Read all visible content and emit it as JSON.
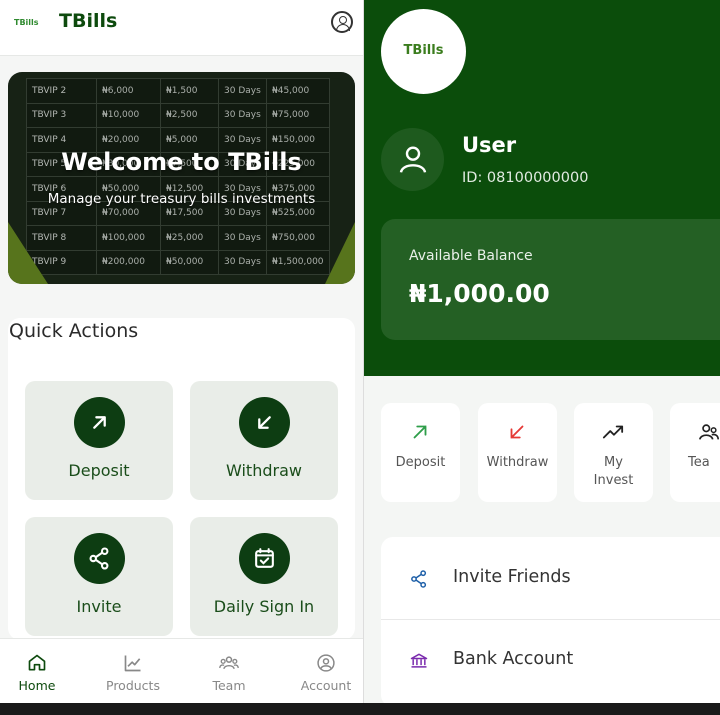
{
  "left": {
    "header": {
      "logo_text": "TBills",
      "title": "TBills",
      "account_icon": "user-circle-icon"
    },
    "hero": {
      "title": "Welcome to TBills",
      "subtitle": "Manage your treasury bills investments",
      "rows": [
        [
          "TBVIP 2",
          "₦6,000",
          "₦1,500",
          "30 Days",
          "₦45,000"
        ],
        [
          "TBVIP 3",
          "₦10,000",
          "₦2,500",
          "30 Days",
          "₦75,000"
        ],
        [
          "TBVIP 4",
          "₦20,000",
          "₦5,000",
          "30 Days",
          "₦150,000"
        ],
        [
          "TBVIP 5",
          "₦30,000",
          "₦7,500",
          "30 Days",
          "₦225,000"
        ],
        [
          "TBVIP 6",
          "₦50,000",
          "₦12,500",
          "30 Days",
          "₦375,000"
        ],
        [
          "TBVIP 7",
          "₦70,000",
          "₦17,500",
          "30 Days",
          "₦525,000"
        ],
        [
          "TBVIP 8",
          "₦100,000",
          "₦25,000",
          "30 Days",
          "₦750,000"
        ],
        [
          "TBVIP 9",
          "₦200,000",
          "₦50,000",
          "30 Days",
          "₦1,500,000"
        ]
      ]
    },
    "quick_actions": {
      "title": "Quick Actions",
      "deposit": "Deposit",
      "withdraw": "Withdraw",
      "invite": "Invite",
      "daily_sign_in": "Daily Sign In"
    },
    "nav": {
      "home": "Home",
      "products": "Products",
      "team": "Team",
      "account": "Account"
    }
  },
  "right": {
    "logo_text": "TBills",
    "user": {
      "name": "User",
      "id": "ID: 08100000000"
    },
    "balance": {
      "label": "Available Balance",
      "value": "₦1,000.00"
    },
    "actions": {
      "deposit": "Deposit",
      "withdraw": "Withdraw",
      "my_invest_line1": "My",
      "my_invest_line2": "Invest",
      "team": "Tea"
    },
    "menu": {
      "invite": "Invite Friends",
      "bank": "Bank Account"
    }
  },
  "colors": {
    "brand_dark": "#0b4d0b",
    "brand_green": "#0d3d12",
    "withdraw_red": "#e53935",
    "deposit_green": "#2e9e4a"
  }
}
